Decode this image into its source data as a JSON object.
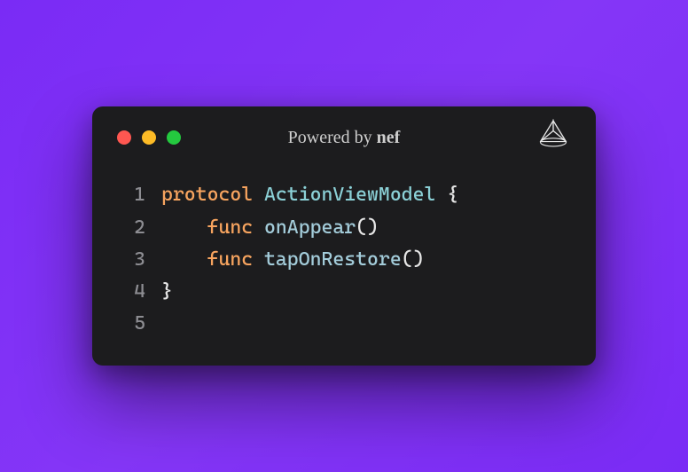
{
  "title_prefix": "Powered by ",
  "title_brand": "nef",
  "traffic_lights": {
    "red": "#ff5751",
    "yellow": "#fdbb26",
    "green": "#24c93f"
  },
  "code": {
    "lines": [
      {
        "num": "1",
        "tokens": [
          {
            "cls": "kw",
            "t": "protocol"
          },
          {
            "cls": "plain",
            "t": " "
          },
          {
            "cls": "type",
            "t": "ActionViewModel"
          },
          {
            "cls": "plain",
            "t": " "
          },
          {
            "cls": "punc",
            "t": "{"
          }
        ]
      },
      {
        "num": "2",
        "tokens": [
          {
            "cls": "plain",
            "t": "    "
          },
          {
            "cls": "kw",
            "t": "func"
          },
          {
            "cls": "plain",
            "t": " "
          },
          {
            "cls": "fn",
            "t": "onAppear"
          },
          {
            "cls": "punc",
            "t": "()"
          }
        ]
      },
      {
        "num": "3",
        "tokens": [
          {
            "cls": "plain",
            "t": "    "
          },
          {
            "cls": "kw",
            "t": "func"
          },
          {
            "cls": "plain",
            "t": " "
          },
          {
            "cls": "fn",
            "t": "tapOnRestore"
          },
          {
            "cls": "punc",
            "t": "()"
          }
        ]
      },
      {
        "num": "4",
        "tokens": [
          {
            "cls": "punc",
            "t": "}"
          }
        ]
      },
      {
        "num": "5",
        "tokens": []
      }
    ]
  }
}
